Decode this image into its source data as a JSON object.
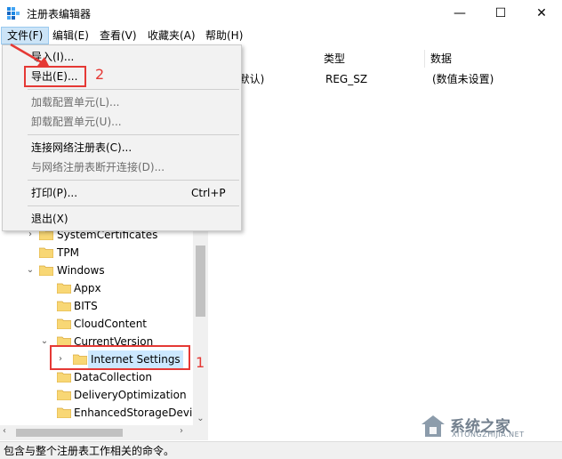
{
  "window": {
    "title": "注册表编辑器",
    "min_glyph": "—",
    "max_glyph": "☐",
    "close_glyph": "✕"
  },
  "menubar": {
    "file": "文件(F)",
    "edit": "编辑(E)",
    "view": "查看(V)",
    "favorites": "收藏夹(A)",
    "help": "帮助(H)"
  },
  "file_menu": {
    "import": "导入(I)...",
    "export": "导出(E)...",
    "load_hive": "加载配置单元(L)...",
    "unload_hive": "卸载配置单元(U)...",
    "connect": "连接网络注册表(C)...",
    "disconnect": "与网络注册表断开连接(D)...",
    "print": "打印(P)...",
    "print_shortcut": "Ctrl+P",
    "exit": "退出(X)"
  },
  "tree": {
    "items": [
      {
        "label": "SystemCertificates"
      },
      {
        "label": "TPM"
      },
      {
        "label": "Windows"
      },
      {
        "label": "Appx"
      },
      {
        "label": "BITS"
      },
      {
        "label": "CloudContent"
      },
      {
        "label": "CurrentVersion"
      },
      {
        "label": "Internet Settings"
      },
      {
        "label": "DataCollection"
      },
      {
        "label": "DeliveryOptimization"
      },
      {
        "label": "EnhancedStorageDevic"
      }
    ]
  },
  "list": {
    "headers": {
      "type": "类型",
      "data": "数据"
    },
    "rows": [
      {
        "name": "(默认)",
        "type": "REG_SZ",
        "data": "(数值未设置)"
      }
    ]
  },
  "statusbar": {
    "text": "包含与整个注册表工作相关的命令。"
  },
  "annotations": {
    "step1": "1",
    "step2": "2",
    "color": "#e53935"
  },
  "watermark": {
    "text": "系统之家",
    "sub": "XITONGZHIJIA.NET"
  }
}
